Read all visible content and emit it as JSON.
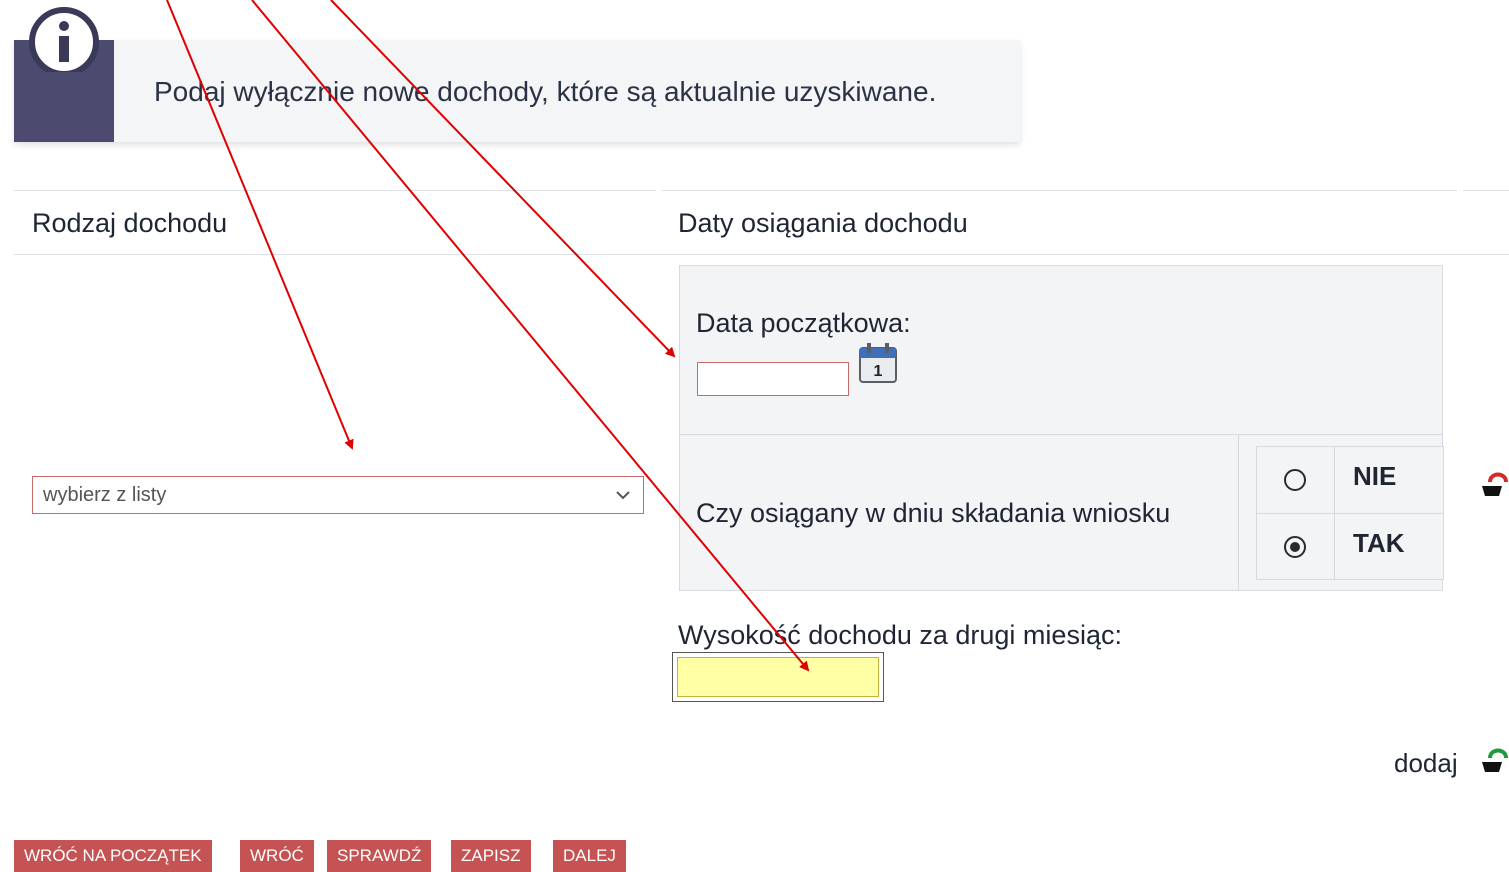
{
  "info": {
    "icon": "info-icon",
    "text": "Podaj wyłącznie nowe dochody, które są aktualnie uzyskiwane."
  },
  "columns": {
    "income_type": "Rodzaj dochodu",
    "dates": "Daty osiągania dochodu"
  },
  "income_select": {
    "value": "wybierz z listy"
  },
  "dates": {
    "start_label": "Data początkowa:",
    "start_value": "",
    "calendar_icon": "calendar-icon",
    "question_label": "Czy osiągany w dniu składania wniosku",
    "options": [
      {
        "label": "NIE",
        "selected": false
      },
      {
        "label": "TAK",
        "selected": true
      }
    ]
  },
  "amount": {
    "label": "Wysokość dochodu za drugi miesiąc:",
    "value": ""
  },
  "row_actions": {
    "remove_icon": "remove-basket-icon",
    "add_label": "dodaj",
    "add_icon": "add-basket-icon"
  },
  "buttons": {
    "start_over": "WRÓĆ NA POCZĄTEK",
    "back": "WRÓĆ",
    "check": "SPRAWDŹ",
    "save": "ZAPISZ",
    "next": "DALEJ"
  },
  "colors": {
    "accent": "#c55353",
    "info_bar": "#4c4a6e",
    "highlight_field": "#ffffa6",
    "annotation_arrow": "#e00000"
  }
}
